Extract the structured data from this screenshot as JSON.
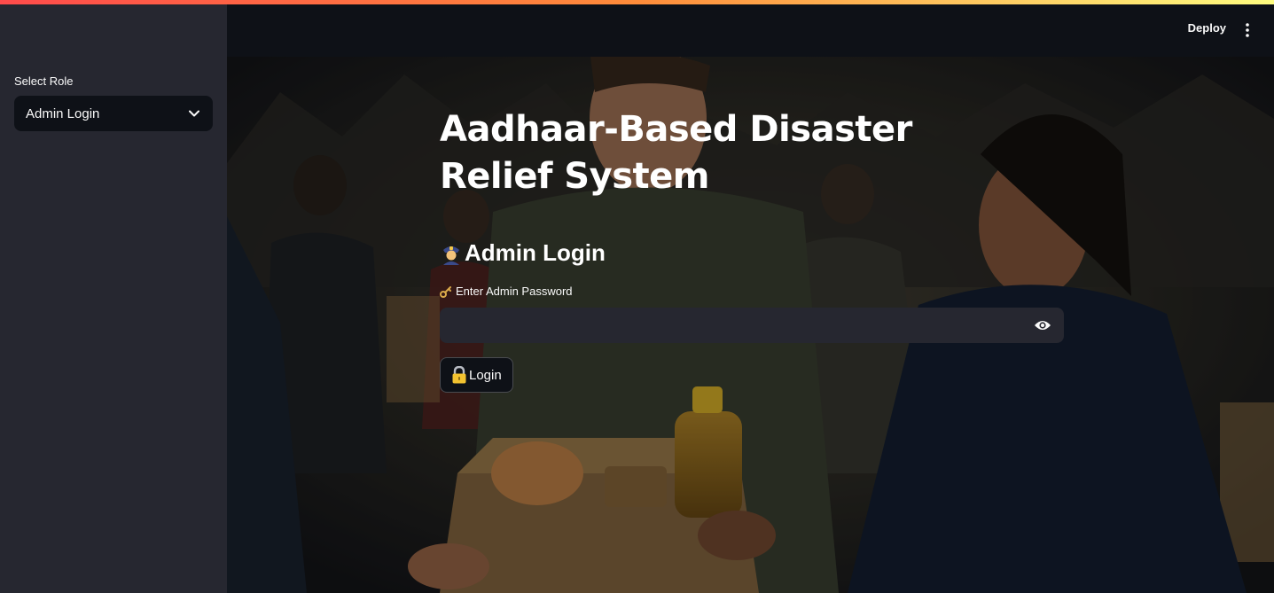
{
  "sidebar": {
    "select_label": "Select Role",
    "select_value": "Admin Login"
  },
  "header": {
    "deploy_label": "Deploy"
  },
  "main": {
    "title": "Aadhaar-Based Disaster Relief System",
    "section_title": "Admin Login",
    "password_label": "Enter Admin Password",
    "password_value": "",
    "login_label": "Login"
  },
  "icons": {
    "chevron": "chevron-down-icon",
    "menu": "vertical-dots-icon",
    "section": "police-officer-icon",
    "field": "key-icon",
    "eye": "eye-icon",
    "login": "lock-icon"
  },
  "colors": {
    "accent_start": "#ff4b4b",
    "accent_end": "#fffd80",
    "sidebar_bg": "#262730",
    "app_bg": "#0e1117",
    "input_bg": "#262730"
  }
}
